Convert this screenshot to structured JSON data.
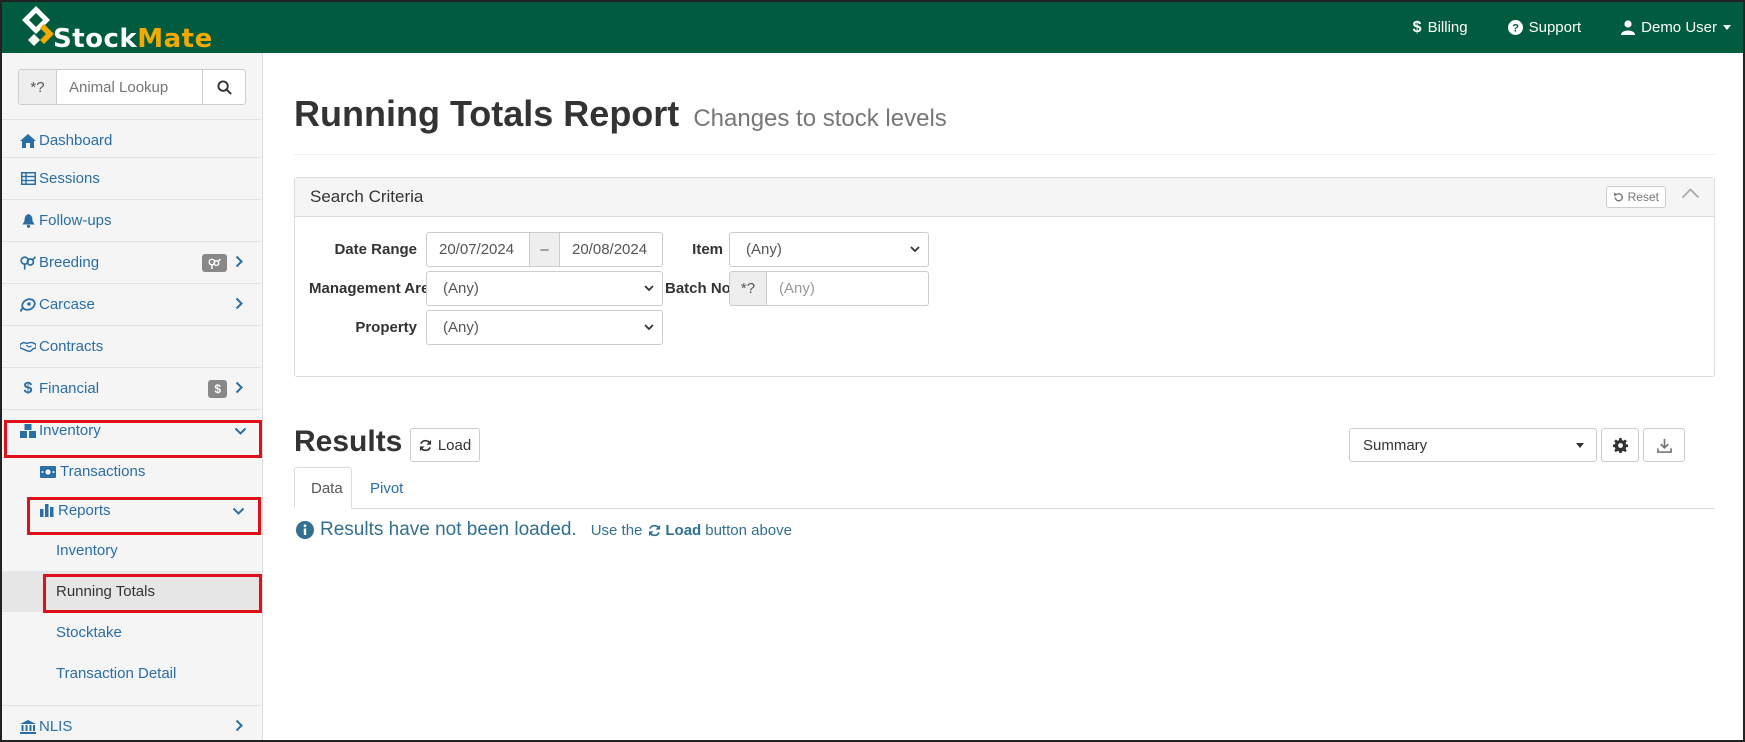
{
  "app": {
    "logo_white": "Stock",
    "logo_yellow": "Mate"
  },
  "topnav": {
    "billing": "Billing",
    "support": "Support",
    "user": "Demo User"
  },
  "sidebar": {
    "search": {
      "wildcard": "*?",
      "placeholder": "Animal Lookup"
    },
    "items": {
      "dashboard": "Dashboard",
      "sessions": "Sessions",
      "followups": "Follow-ups",
      "breeding": "Breeding",
      "carcase": "Carcase",
      "contracts": "Contracts",
      "financial": "Financial",
      "financial_badge": "$",
      "inventory": "Inventory",
      "transactions": "Transactions",
      "reports": "Reports",
      "rep_inventory": "Inventory",
      "rep_running": "Running Totals",
      "rep_stocktake": "Stocktake",
      "rep_txdetail": "Transaction Detail",
      "nlis": "NLIS"
    }
  },
  "page": {
    "title": "Running Totals Report",
    "subtitle": "Changes to stock levels"
  },
  "criteria": {
    "heading": "Search Criteria",
    "reset": "Reset",
    "date_range_label": "Date Range",
    "date_from": "20/07/2024",
    "date_sep": "–",
    "date_to": "20/08/2024",
    "item_label": "Item",
    "item_value": "(Any)",
    "mgmt_label": "Management Area",
    "mgmt_value": "(Any)",
    "batch_label": "Batch No.",
    "batch_wild": "*?",
    "batch_placeholder": "(Any)",
    "property_label": "Property",
    "property_value": "(Any)"
  },
  "results": {
    "title": "Results",
    "load": "Load",
    "view_select": "Summary",
    "tabs": [
      "Data",
      "Pivot"
    ],
    "msg_main": "Results have not been loaded.",
    "msg_use": "Use the",
    "msg_load": "Load",
    "msg_tail": "button above"
  },
  "colors": {
    "nav_green": "#015c3f",
    "link_blue": "#2a6ea6",
    "logo_yellow": "#f2a900",
    "highlight_red": "#e0101a"
  }
}
